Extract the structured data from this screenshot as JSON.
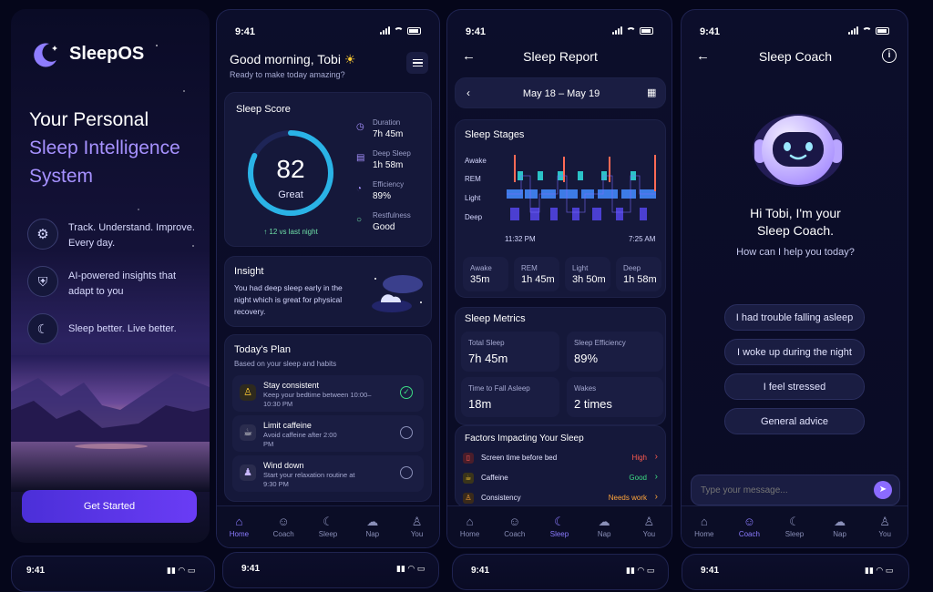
{
  "brand": {
    "name": "SleepOS"
  },
  "landing": {
    "headline_1": "Your Personal",
    "headline_2": "Sleep Intelligence",
    "headline_3": "System",
    "features": [
      {
        "icon": "gear-icon",
        "text": "Track. Understand. Improve. Every day."
      },
      {
        "icon": "shield-icon",
        "text": "AI-powered insights that adapt to you"
      },
      {
        "icon": "moon-icon",
        "text": "Sleep better. Live better."
      }
    ],
    "cta": "Get Started"
  },
  "status": {
    "time": "9:41"
  },
  "home": {
    "greeting": "Good morning, Tobi",
    "subtitle": "Ready to make today amazing?",
    "score_card": {
      "title": "Sleep Score",
      "score": "82",
      "score_value": 82,
      "rating": "Great",
      "delta": "↑ 12 vs last night",
      "stats": [
        {
          "label": "Duration",
          "value": "7h 45m"
        },
        {
          "label": "Deep Sleep",
          "value": "1h 58m"
        },
        {
          "label": "Efficiency",
          "value": "89%"
        },
        {
          "label": "Restfulness",
          "value": "Good"
        }
      ]
    },
    "insight": {
      "title": "Insight",
      "text": "You had deep sleep early in the night which is great for physical recovery."
    },
    "plan": {
      "title": "Today's Plan",
      "subtitle": "Based on your sleep and habits",
      "items": [
        {
          "title": "Stay consistent",
          "desc": "Keep your bedtime between 10:00–10:30 PM",
          "done": true
        },
        {
          "title": "Limit caffeine",
          "desc": "Avoid caffeine after 2:00 PM",
          "done": false
        },
        {
          "title": "Wind down",
          "desc": "Start your relaxation routine at 9:30 PM",
          "done": false
        }
      ]
    }
  },
  "report": {
    "title": "Sleep Report",
    "date_range": "May 18 – May 19",
    "stages_title": "Sleep Stages",
    "stage_labels": [
      "Awake",
      "REM",
      "Light",
      "Deep"
    ],
    "start_time": "11:32 PM",
    "end_time": "7:25 AM",
    "stage_totals": [
      {
        "label": "Awake",
        "value": "35m"
      },
      {
        "label": "REM",
        "value": "1h 45m"
      },
      {
        "label": "Light",
        "value": "3h 50m"
      },
      {
        "label": "Deep",
        "value": "1h 58m"
      }
    ],
    "metrics_title": "Sleep Metrics",
    "metrics": [
      {
        "label": "Total Sleep",
        "value": "7h 45m"
      },
      {
        "label": "Sleep Efficiency",
        "value": "89%"
      },
      {
        "label": "Time to Fall Asleep",
        "value": "18m"
      },
      {
        "label": "Wakes",
        "value": "2 times"
      }
    ],
    "factors_title": "Factors Impacting Your Sleep",
    "factors": [
      {
        "label": "Screen time before bed",
        "status": "High",
        "color": "#ff5a4e"
      },
      {
        "label": "Caffeine",
        "status": "Good",
        "color": "#3ddc84"
      },
      {
        "label": "Consistency",
        "status": "Needs work",
        "color": "#ffa53a"
      }
    ]
  },
  "coach": {
    "title": "Sleep Coach",
    "greeting_1": "Hi Tobi, I'm your",
    "greeting_2": "Sleep Coach.",
    "prompt": "How can I help you today?",
    "suggestions": [
      "I had trouble falling asleep",
      "I woke up during the night",
      "I feel stressed",
      "General advice"
    ],
    "input_placeholder": "Type your message..."
  },
  "nav": {
    "tabs": [
      "Home",
      "Coach",
      "Sleep",
      "Nap",
      "You"
    ]
  },
  "colors": {
    "accent": "#7b5cff",
    "ring": "#2ab3e6",
    "bg": "#0a0b24"
  }
}
